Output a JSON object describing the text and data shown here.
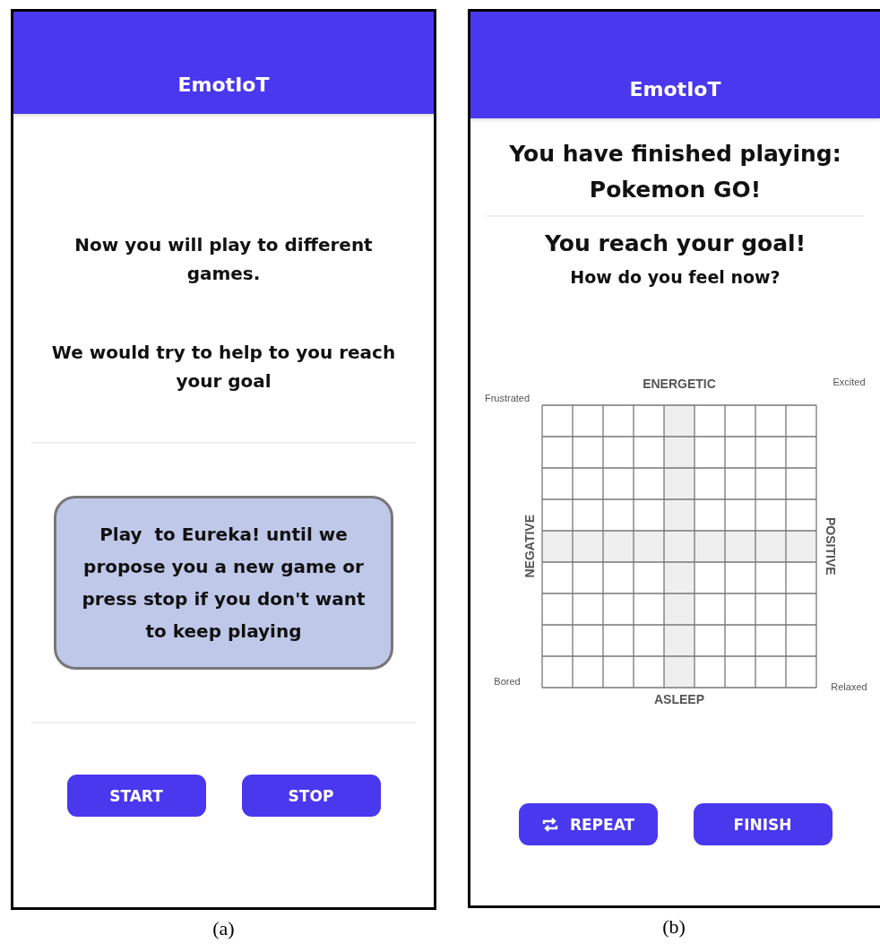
{
  "panels": [
    {
      "kind": "intro",
      "caption": "(a)",
      "header": {
        "title": "EmotIoT"
      },
      "paragraphs": [
        "Now you will play to different games.",
        "We would try to help to you reach your goal"
      ],
      "message": "Play  to Eureka! until we propose you a new game or press stop if you don't want to keep playing",
      "buttons": [
        {
          "label": "START",
          "has_icon": false
        },
        {
          "label": "STOP",
          "has_icon": false
        }
      ]
    },
    {
      "kind": "result",
      "caption": "(b)",
      "header": {
        "title": "EmotIoT"
      },
      "finished": "You have finished playing: Pokemon GO!",
      "goal": "You reach your goal!",
      "question": "How do you feel now?",
      "mood_grid": {
        "top": "ENERGETIC",
        "bottom": "ASLEEP",
        "left": "NEGATIVE",
        "right": "POSITIVE",
        "top_left": "Frustrated",
        "top_right": "Excited",
        "bottom_left": "Bored",
        "bottom_right": "Relaxed"
      },
      "buttons": [
        {
          "label": "REPEAT",
          "has_icon": true
        },
        {
          "label": "FINISH",
          "has_icon": false
        }
      ]
    }
  ]
}
